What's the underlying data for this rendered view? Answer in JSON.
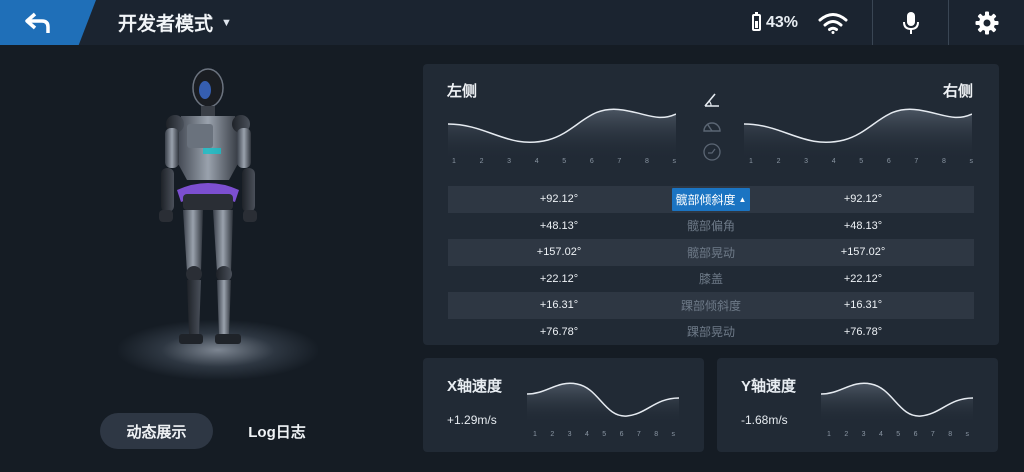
{
  "header": {
    "mode_title": "开发者模式",
    "battery_percent": "43%"
  },
  "icons": {
    "back": "back-arrow-icon",
    "caret": "caret-down-icon",
    "battery": "battery-icon",
    "wifi": "wifi-icon",
    "mic": "microphone-icon",
    "settings": "gear-icon"
  },
  "colors": {
    "accent": "#1f6fb8",
    "selected_row": "#1b74c2",
    "background": "#151c24",
    "panel": "#212a35"
  },
  "joint_panel": {
    "left_label": "左侧",
    "right_label": "右侧",
    "tick_labels": [
      "1",
      "2",
      "3",
      "4",
      "5",
      "6",
      "7",
      "8",
      "s"
    ],
    "rows": [
      {
        "left": "+92.12°",
        "name": "髋部倾斜度",
        "right": "+92.12°",
        "selected": true
      },
      {
        "left": "+48.13°",
        "name": "髋部偏角",
        "right": "+48.13°"
      },
      {
        "left": "+157.02°",
        "name": "髋部晃动",
        "right": "+157.02°"
      },
      {
        "left": "+22.12°",
        "name": "膝盖",
        "right": "+22.12°"
      },
      {
        "left": "+16.31°",
        "name": "踝部倾斜度",
        "right": "+16.31°"
      },
      {
        "left": "+76.78°",
        "name": "踝部晃动",
        "right": "+76.78°"
      }
    ]
  },
  "speed": {
    "x": {
      "title": "X轴速度",
      "value": "+1.29m/s"
    },
    "y": {
      "title": "Y轴速度",
      "value": "-1.68m/s"
    }
  },
  "bottom_buttons": {
    "dynamic": "动态展示",
    "log": "Log日志"
  }
}
